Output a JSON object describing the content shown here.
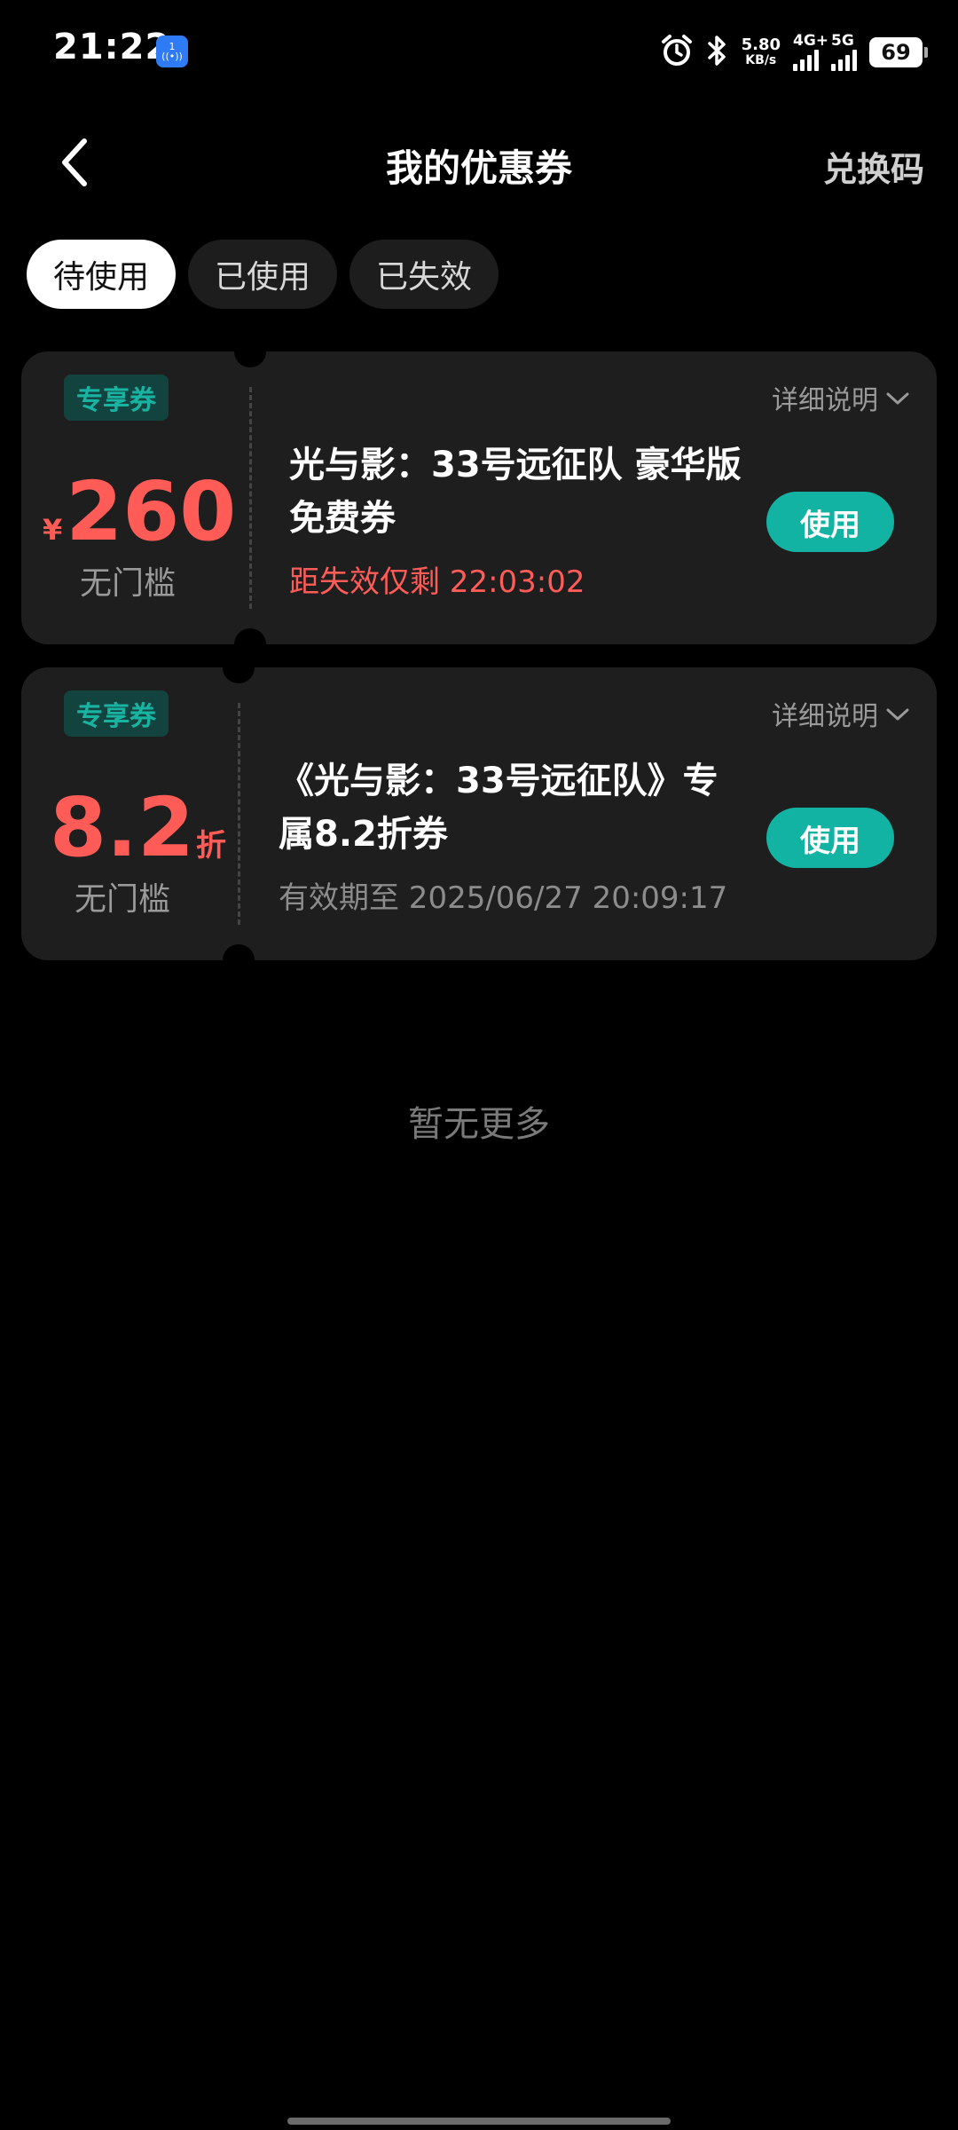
{
  "status_bar": {
    "time": "21:22",
    "net_speed_value": "5.80",
    "net_speed_unit": "KB/s",
    "sim1_label": "4G+",
    "sim2_label": "5G",
    "battery": "69"
  },
  "nav": {
    "title": "我的优惠券",
    "redeem_label": "兑换码"
  },
  "tabs": [
    {
      "label": "待使用",
      "active": true
    },
    {
      "label": "已使用",
      "active": false
    },
    {
      "label": "已失效",
      "active": false
    }
  ],
  "coupons": [
    {
      "badge": "专享券",
      "detail_label": "详细说明",
      "currency": "¥",
      "value": "260",
      "threshold": "无门槛",
      "title": "光与影：33号远征队 豪华版免费券",
      "subtitle": "距失效仅剩 22:03:02",
      "action": "使用"
    },
    {
      "badge": "专享券",
      "detail_label": "详细说明",
      "value": "8.2",
      "value_suffix": "折",
      "threshold": "无门槛",
      "title": "《光与影：33号远征队》专属8.2折券",
      "subtitle": "有效期至 2025/06/27 20:09:17",
      "action": "使用"
    }
  ],
  "footer_text": "暂无更多",
  "colors": {
    "accent": "#12b3a3",
    "price_red": "#ff5b57",
    "card_bg": "#1e1e1e"
  }
}
